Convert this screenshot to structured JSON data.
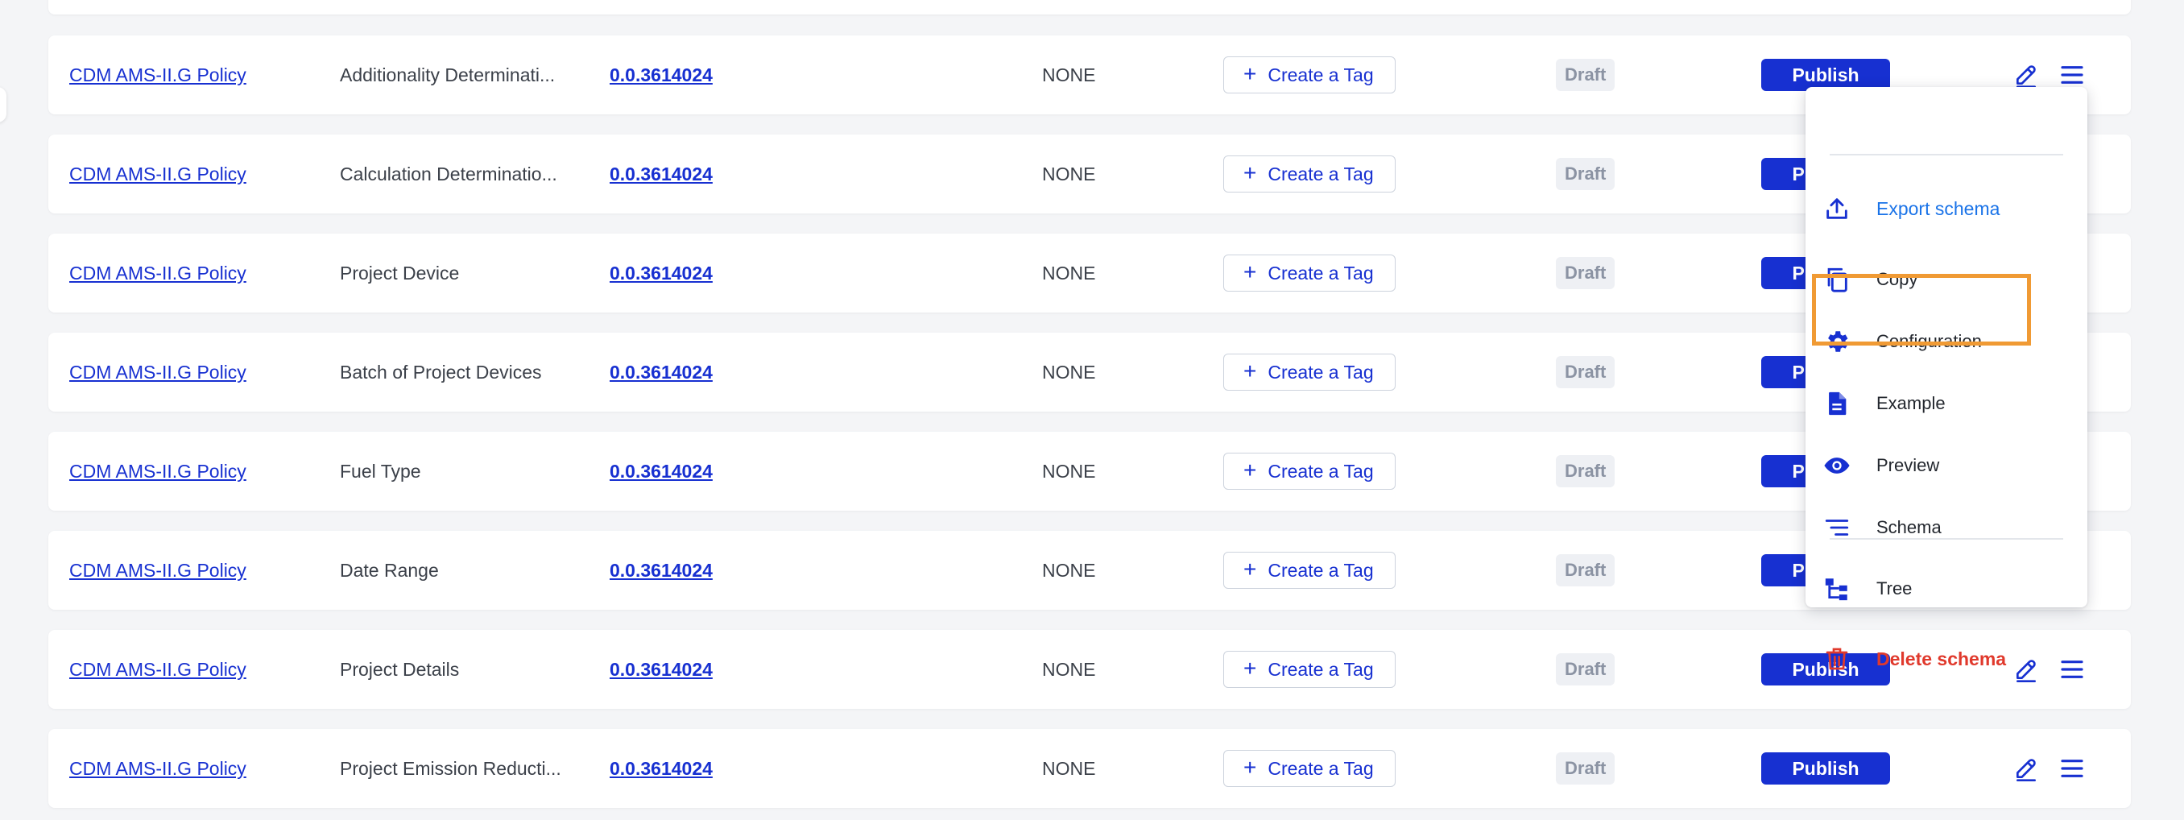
{
  "rows": [
    {
      "policy": "CDM AMS-II.G Policy",
      "name": "Additionality Determinati...",
      "topic": "0.0.3614024",
      "status": "NONE",
      "tag_label": "Create a Tag",
      "state": "Draft",
      "publish_label": "Publish"
    },
    {
      "policy": "CDM AMS-II.G Policy",
      "name": "Calculation Determinatio...",
      "topic": "0.0.3614024",
      "status": "NONE",
      "tag_label": "Create a Tag",
      "state": "Draft",
      "publish_label": "Publish"
    },
    {
      "policy": "CDM AMS-II.G Policy",
      "name": "Project Device",
      "topic": "0.0.3614024",
      "status": "NONE",
      "tag_label": "Create a Tag",
      "state": "Draft",
      "publish_label": "Publish"
    },
    {
      "policy": "CDM AMS-II.G Policy",
      "name": "Batch of Project Devices",
      "topic": "0.0.3614024",
      "status": "NONE",
      "tag_label": "Create a Tag",
      "state": "Draft",
      "publish_label": "Publish"
    },
    {
      "policy": "CDM AMS-II.G Policy",
      "name": "Fuel Type",
      "topic": "0.0.3614024",
      "status": "NONE",
      "tag_label": "Create a Tag",
      "state": "Draft",
      "publish_label": "Publish"
    },
    {
      "policy": "CDM AMS-II.G Policy",
      "name": "Date Range",
      "topic": "0.0.3614024",
      "status": "NONE",
      "tag_label": "Create a Tag",
      "state": "Draft",
      "publish_label": "Publish"
    },
    {
      "policy": "CDM AMS-II.G Policy",
      "name": "Project Details",
      "topic": "0.0.3614024",
      "status": "NONE",
      "tag_label": "Create a Tag",
      "state": "Draft",
      "publish_label": "Publish"
    },
    {
      "policy": "CDM AMS-II.G Policy",
      "name": "Project Emission Reducti...",
      "topic": "0.0.3614024",
      "status": "NONE",
      "tag_label": "Create a Tag",
      "state": "Draft",
      "publish_label": "Publish"
    }
  ],
  "menu": {
    "items": [
      {
        "label": "Export schema",
        "icon": "upload-icon",
        "style": "accent"
      },
      {
        "label": "Copy",
        "icon": "copy-icon",
        "style": "normal"
      },
      {
        "label": "Configuration",
        "icon": "gear-icon",
        "style": "normal"
      },
      {
        "label": "Example",
        "icon": "document-icon",
        "style": "normal",
        "highlighted": true
      },
      {
        "label": "Preview",
        "icon": "eye-icon",
        "style": "normal"
      },
      {
        "label": "Schema",
        "icon": "list-lines-icon",
        "style": "normal"
      },
      {
        "label": "Tree",
        "icon": "tree-icon",
        "style": "normal"
      },
      {
        "label": "Delete schema",
        "icon": "trash-icon",
        "style": "danger"
      }
    ]
  },
  "colors": {
    "primary": "#1730d1",
    "accent_link": "#1a73e8",
    "danger": "#e0392c",
    "highlight_border": "#f09a34",
    "draft_bg": "#eef0f4"
  }
}
